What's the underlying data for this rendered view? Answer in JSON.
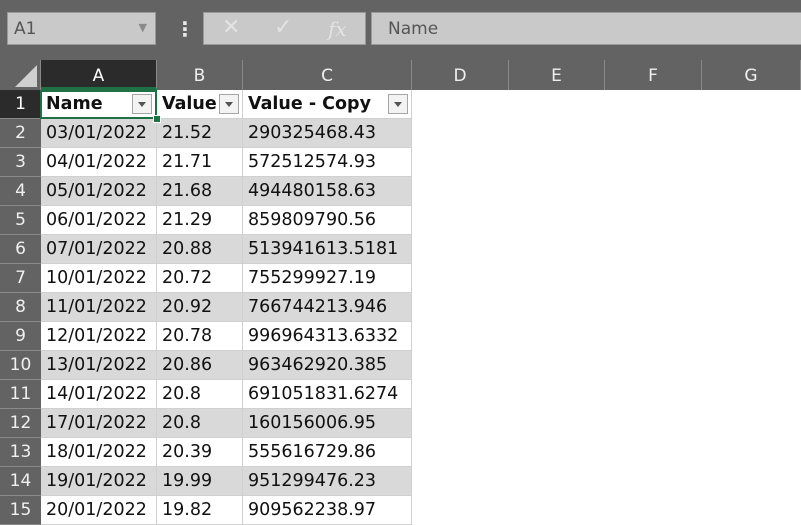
{
  "formula_bar": {
    "name_box": "A1",
    "formula_value": "Name",
    "icons": [
      "more-options-icon",
      "cancel-icon",
      "enter-icon",
      "insert-function-icon"
    ],
    "cancel_glyph": "✕",
    "enter_glyph": "✓",
    "fx_glyph": "fx",
    "kebab_glyph": "⋮",
    "dropdown_glyph": "▼"
  },
  "columns": [
    "A",
    "B",
    "C",
    "D",
    "E",
    "F",
    "G"
  ],
  "rows": [
    "1",
    "2",
    "3",
    "4",
    "5",
    "6",
    "7",
    "8",
    "9",
    "10",
    "11",
    "12",
    "13",
    "14",
    "15"
  ],
  "table": {
    "headers": [
      "Name",
      "Value",
      "Value - Copy"
    ],
    "data": [
      [
        "03/01/2022",
        "21.52",
        "290325468.43"
      ],
      [
        "04/01/2022",
        "21.71",
        "572512574.93"
      ],
      [
        "05/01/2022",
        "21.68",
        "494480158.63"
      ],
      [
        "06/01/2022",
        "21.29",
        "859809790.56"
      ],
      [
        "07/01/2022",
        "20.88",
        "513941613.5181"
      ],
      [
        "10/01/2022",
        "20.72",
        "755299927.19"
      ],
      [
        "11/01/2022",
        "20.92",
        "766744213.946"
      ],
      [
        "12/01/2022",
        "20.78",
        "996964313.6332"
      ],
      [
        "13/01/2022",
        "20.86",
        "963462920.385"
      ],
      [
        "14/01/2022",
        "20.8",
        "691051831.6274"
      ],
      [
        "17/01/2022",
        "20.8",
        "160156006.95"
      ],
      [
        "18/01/2022",
        "20.39",
        "555616729.86"
      ],
      [
        "19/01/2022",
        "19.99",
        "951299476.23"
      ],
      [
        "20/01/2022",
        "19.82",
        "909562238.97"
      ]
    ]
  },
  "colors": {
    "accent": "#1e7145",
    "header_bg": "#636363",
    "banded_row": "#d9d9d9"
  }
}
